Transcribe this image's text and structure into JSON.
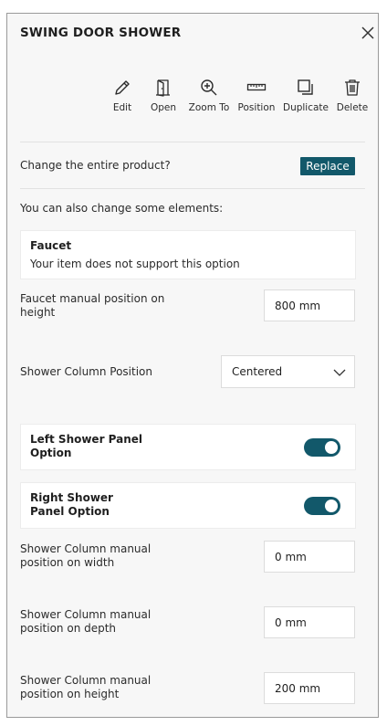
{
  "header": {
    "title": "SWING DOOR SHOWER"
  },
  "toolbar": {
    "items": [
      {
        "label": "Edit",
        "icon": "pencil-icon"
      },
      {
        "label": "Open",
        "icon": "door-icon"
      },
      {
        "label": "Zoom To",
        "icon": "zoom-in-icon"
      },
      {
        "label": "Position",
        "icon": "ruler-icon"
      },
      {
        "label": "Duplicate",
        "icon": "duplicate-icon"
      },
      {
        "label": "Delete",
        "icon": "trash-icon"
      }
    ]
  },
  "product": {
    "change_prompt": "Change the entire product?",
    "replace_label": "Replace"
  },
  "elements_intro": "You can also change some elements:",
  "faucet": {
    "title": "Faucet",
    "message": "Your item does not support this option"
  },
  "fields": {
    "faucet_height": {
      "label": "Faucet manual position on height",
      "value": "800 mm"
    },
    "column_position": {
      "label": "Shower Column Position",
      "value": "Centered"
    },
    "column_width": {
      "label": "Shower Column manual position on width",
      "value": "0 mm"
    },
    "column_depth": {
      "label": "Shower Column manual position on depth",
      "value": "0 mm"
    },
    "column_height": {
      "label": "Shower Column manual position on height",
      "value": "200 mm"
    }
  },
  "toggles": {
    "left_panel": {
      "label": "Left Shower Panel Option",
      "on": true
    },
    "right_panel": {
      "label": "Right Shower Panel Option",
      "on": true
    }
  },
  "colors": {
    "accent": "#12586a",
    "panel_bg": "#f7f7f7",
    "card_bg": "#ffffff",
    "border": "#9a9a9a"
  }
}
